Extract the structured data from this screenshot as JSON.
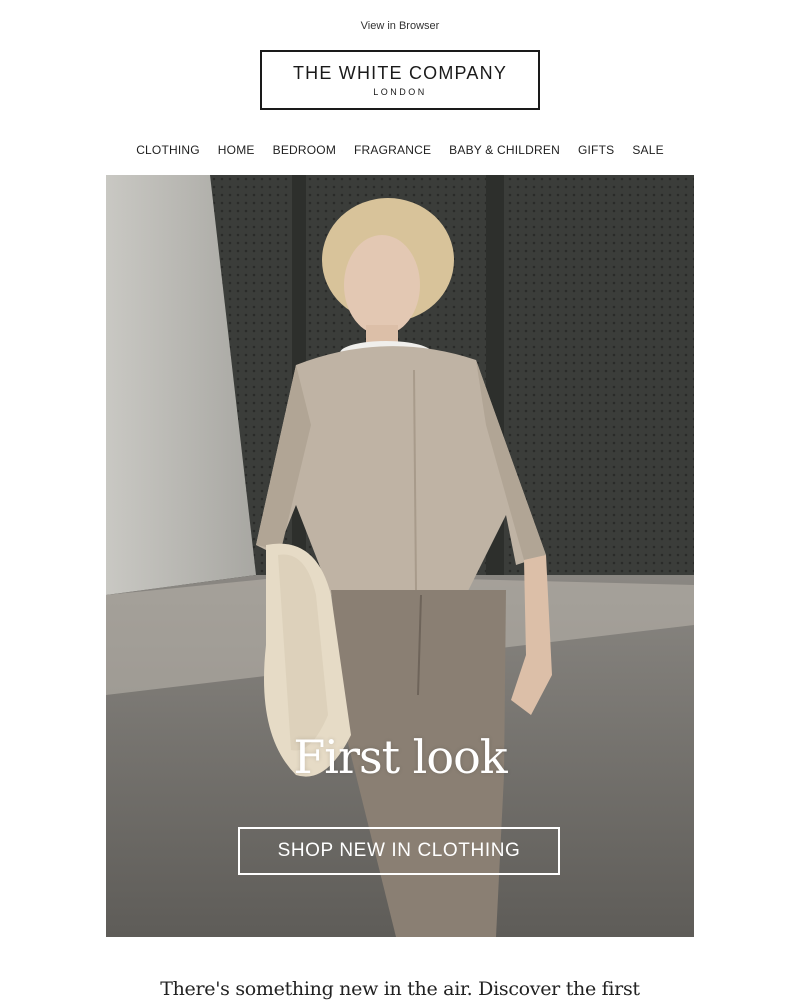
{
  "header": {
    "view_in_browser": "View in Browser",
    "logo_main": "THE WHITE COMPANY",
    "logo_sub": "LONDON"
  },
  "nav": {
    "items": [
      "CLOTHING",
      "HOME",
      "BEDROOM",
      "FRAGRANCE",
      "BABY & CHILDREN",
      "GIFTS",
      "SALE"
    ]
  },
  "hero": {
    "title": "First look",
    "cta_label": "SHOP NEW IN CLOTHING",
    "image_icon": "model-photo"
  },
  "intro": {
    "text": "There's something new in the air. Discover the first"
  }
}
